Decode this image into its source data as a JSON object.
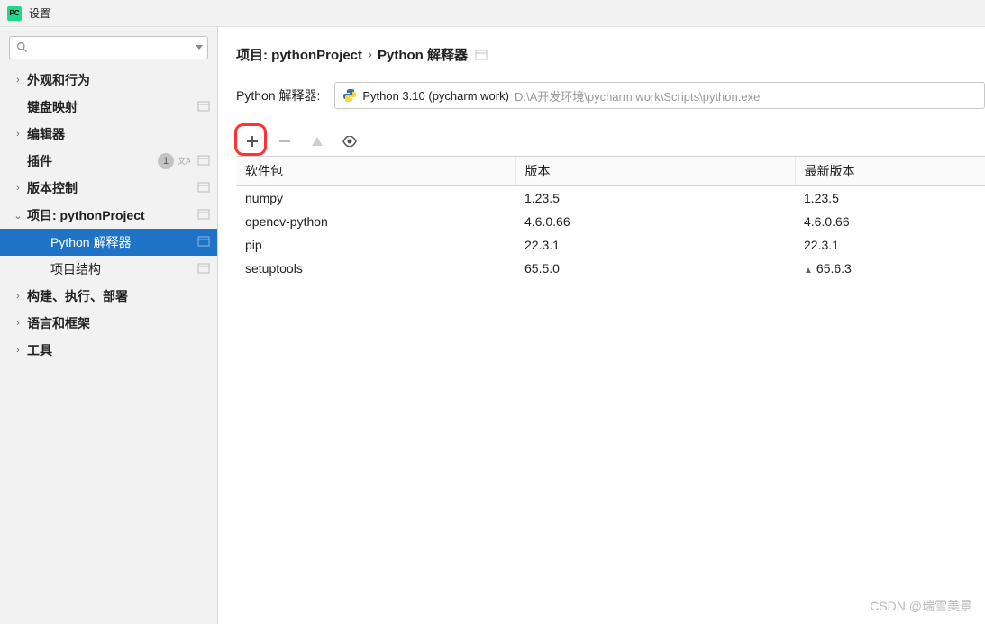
{
  "window": {
    "title": "设置"
  },
  "sidebar": {
    "search_placeholder": "",
    "items": [
      {
        "label": "外观和行为",
        "expandable": true,
        "chevron": "›",
        "bold": true
      },
      {
        "label": "键盘映射",
        "expandable": false,
        "bold": true,
        "sep": true
      },
      {
        "label": "编辑器",
        "expandable": true,
        "chevron": "›",
        "bold": true
      },
      {
        "label": "插件",
        "expandable": false,
        "bold": true,
        "badge": "1",
        "lang": true,
        "sep": true
      },
      {
        "label": "版本控制",
        "expandable": true,
        "chevron": "›",
        "bold": true,
        "sep": true
      },
      {
        "label": "项目: pythonProject",
        "expandable": true,
        "chevron": "⌄",
        "bold": true,
        "sep": true
      },
      {
        "label": "Python 解释器",
        "indent": 1,
        "selected": true,
        "sep": true
      },
      {
        "label": "项目结构",
        "indent": 1,
        "sep": true
      },
      {
        "label": "构建、执行、部署",
        "expandable": true,
        "chevron": "›",
        "bold": true
      },
      {
        "label": "语言和框架",
        "expandable": true,
        "chevron": "›",
        "bold": true
      },
      {
        "label": "工具",
        "expandable": true,
        "chevron": "›",
        "bold": true
      }
    ]
  },
  "breadcrumb": {
    "part1": "项目: pythonProject",
    "sep": "›",
    "part2": "Python 解释器"
  },
  "interpreter": {
    "label": "Python 解释器:",
    "name": "Python 3.10 (pycharm work)",
    "path": "D:\\A开发环境\\pycharm work\\Scripts\\python.exe"
  },
  "table": {
    "headers": {
      "pkg": "软件包",
      "ver": "版本",
      "latest": "最新版本"
    },
    "rows": [
      {
        "name": "numpy",
        "version": "1.23.5",
        "latest": "1.23.5",
        "upgrade": false
      },
      {
        "name": "opencv-python",
        "version": "4.6.0.66",
        "latest": "4.6.0.66",
        "upgrade": false
      },
      {
        "name": "pip",
        "version": "22.3.1",
        "latest": "22.3.1",
        "upgrade": false
      },
      {
        "name": "setuptools",
        "version": "65.5.0",
        "latest": "65.6.3",
        "upgrade": true
      }
    ]
  },
  "watermark": "CSDN @瑞雪美景"
}
